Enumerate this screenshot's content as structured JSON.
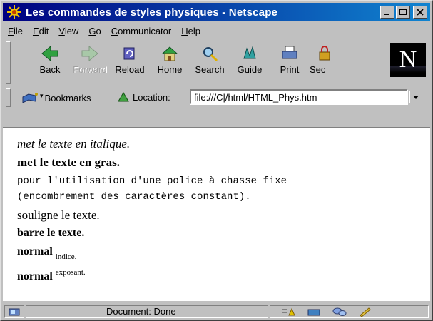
{
  "window": {
    "title": "Les commandes de styles physiques - Netscape"
  },
  "menu": {
    "items": [
      {
        "u": "F",
        "rest": "ile"
      },
      {
        "u": "E",
        "rest": "dit"
      },
      {
        "u": "V",
        "rest": "iew"
      },
      {
        "u": "G",
        "rest": "o"
      },
      {
        "u": "C",
        "rest": "ommunicator"
      },
      {
        "u": "H",
        "rest": "elp"
      }
    ]
  },
  "toolbar": {
    "buttons": [
      {
        "label": "Back",
        "icon": "back-arrow-icon"
      },
      {
        "label": "Forward",
        "icon": "forward-arrow-icon",
        "disabled": true
      },
      {
        "label": "Reload",
        "icon": "reload-icon"
      },
      {
        "label": "Home",
        "icon": "home-icon"
      },
      {
        "label": "Search",
        "icon": "search-icon"
      },
      {
        "label": "Guide",
        "icon": "guide-icon"
      },
      {
        "label": "Print",
        "icon": "print-icon"
      },
      {
        "label": "Sec",
        "icon": "security-icon"
      }
    ],
    "logo_letter": "N"
  },
  "location": {
    "bookmarks_label": "Bookmarks",
    "location_label": "Location:",
    "url": "file:///C|/html/HTML_Phys.htm"
  },
  "content": {
    "italic": "met le texte en italique.",
    "bold": "met le texte en gras.",
    "mono_line1": "pour l'utilisation d'une police à chasse fixe",
    "mono_line2": "(encombrement des caractères constant).",
    "underline": "souligne le texte.",
    "strike": "barre le texte.",
    "sub_normal": "normal",
    "sub_text": "indice.",
    "sup_normal": "normal",
    "sup_text": "exposant."
  },
  "status": {
    "text": "Document: Done"
  },
  "colors": {
    "titlebar_start": "#000080",
    "titlebar_end": "#1084d0",
    "chrome": "#c0c0c0"
  }
}
